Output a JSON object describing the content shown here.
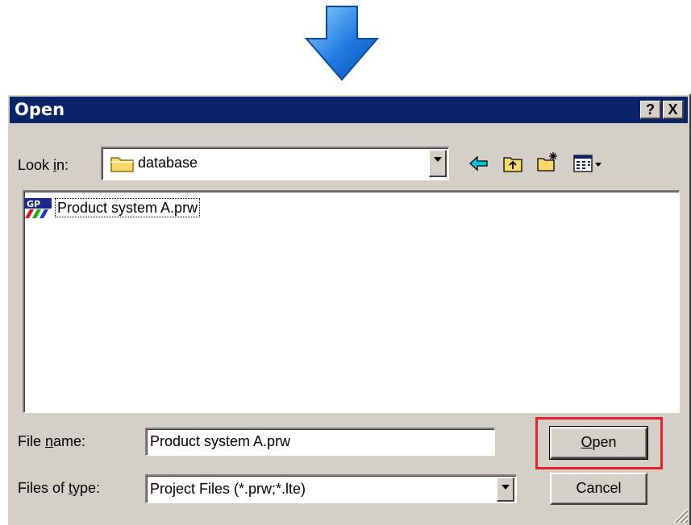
{
  "dialog": {
    "title": "Open",
    "help_button": "?",
    "close_button": "X"
  },
  "look_in": {
    "label_pre": "Look ",
    "label_key": "i",
    "label_post": "n:",
    "value": "database"
  },
  "toolbar": {
    "icons": [
      "back-arrow-icon",
      "up-one-level-icon",
      "new-folder-icon",
      "view-menu-icon"
    ]
  },
  "files": [
    {
      "name": "Product system A.prw",
      "icon": "gp-project-file-icon"
    }
  ],
  "file_name": {
    "label_pre": "File ",
    "label_key": "n",
    "label_post": "ame:",
    "value": "Product system A.prw"
  },
  "file_type": {
    "label_pre": "Files of ",
    "label_key": "t",
    "label_post": "ype:",
    "value": "Project Files (*.prw;*.lte)"
  },
  "buttons": {
    "open_key": "O",
    "open_rest": "pen",
    "cancel": "Cancel"
  },
  "colors": {
    "titlebar": "#0a246a",
    "dialog_face": "#d4d0c8",
    "highlight_box": "#e8202a",
    "arrow": "#1f7be0"
  }
}
